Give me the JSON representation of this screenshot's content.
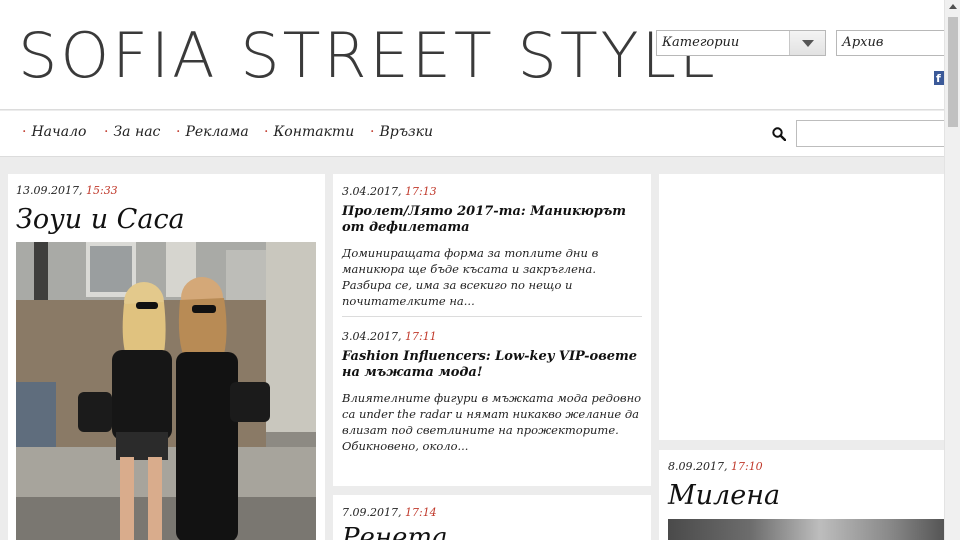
{
  "header": {
    "site_title": "SOFIA STREET STYLE",
    "categories_select": "Категории",
    "archive_select": "Архив",
    "facebook_icon": "facebook-icon"
  },
  "nav": {
    "items": [
      {
        "label": "Начало"
      },
      {
        "label": "За нас"
      },
      {
        "label": "Реклама"
      },
      {
        "label": "Контакти"
      },
      {
        "label": "Връзки"
      }
    ],
    "search_placeholder": ""
  },
  "posts": {
    "left": {
      "date": "13.09.2017, ",
      "time": "15:33",
      "title": "Зоуи и Саса"
    },
    "middle": [
      {
        "date": "3.04.2017, ",
        "time": "17:13",
        "title": "Пролет/Лято 2017-та: Маникюрът от дефилетата",
        "excerpt": "Доминиращата форма за топлите дни в маникюра ще бъде късата и закръглена. Разбира се, има за всекиго по нещо и почитателките на..."
      },
      {
        "date": "3.04.2017, ",
        "time": "17:11",
        "title": "Fashion Influencers: Low-key VIP-овете на мъжата мода!",
        "excerpt": "Влиятелните фигури в мъжката мода редовно са under the radar и нямат никакво желание да влизат под светлините на прожекторите. Обикновено, около..."
      }
    ],
    "middle_bottom": {
      "date": "7.09.2017, ",
      "time": "17:14",
      "title": "Ренета"
    },
    "right": {
      "date": "8.09.2017, ",
      "time": "17:10",
      "title": "Милена"
    }
  },
  "colors": {
    "accent": "#c0392b",
    "background": "#ececec",
    "card": "#ffffff"
  }
}
